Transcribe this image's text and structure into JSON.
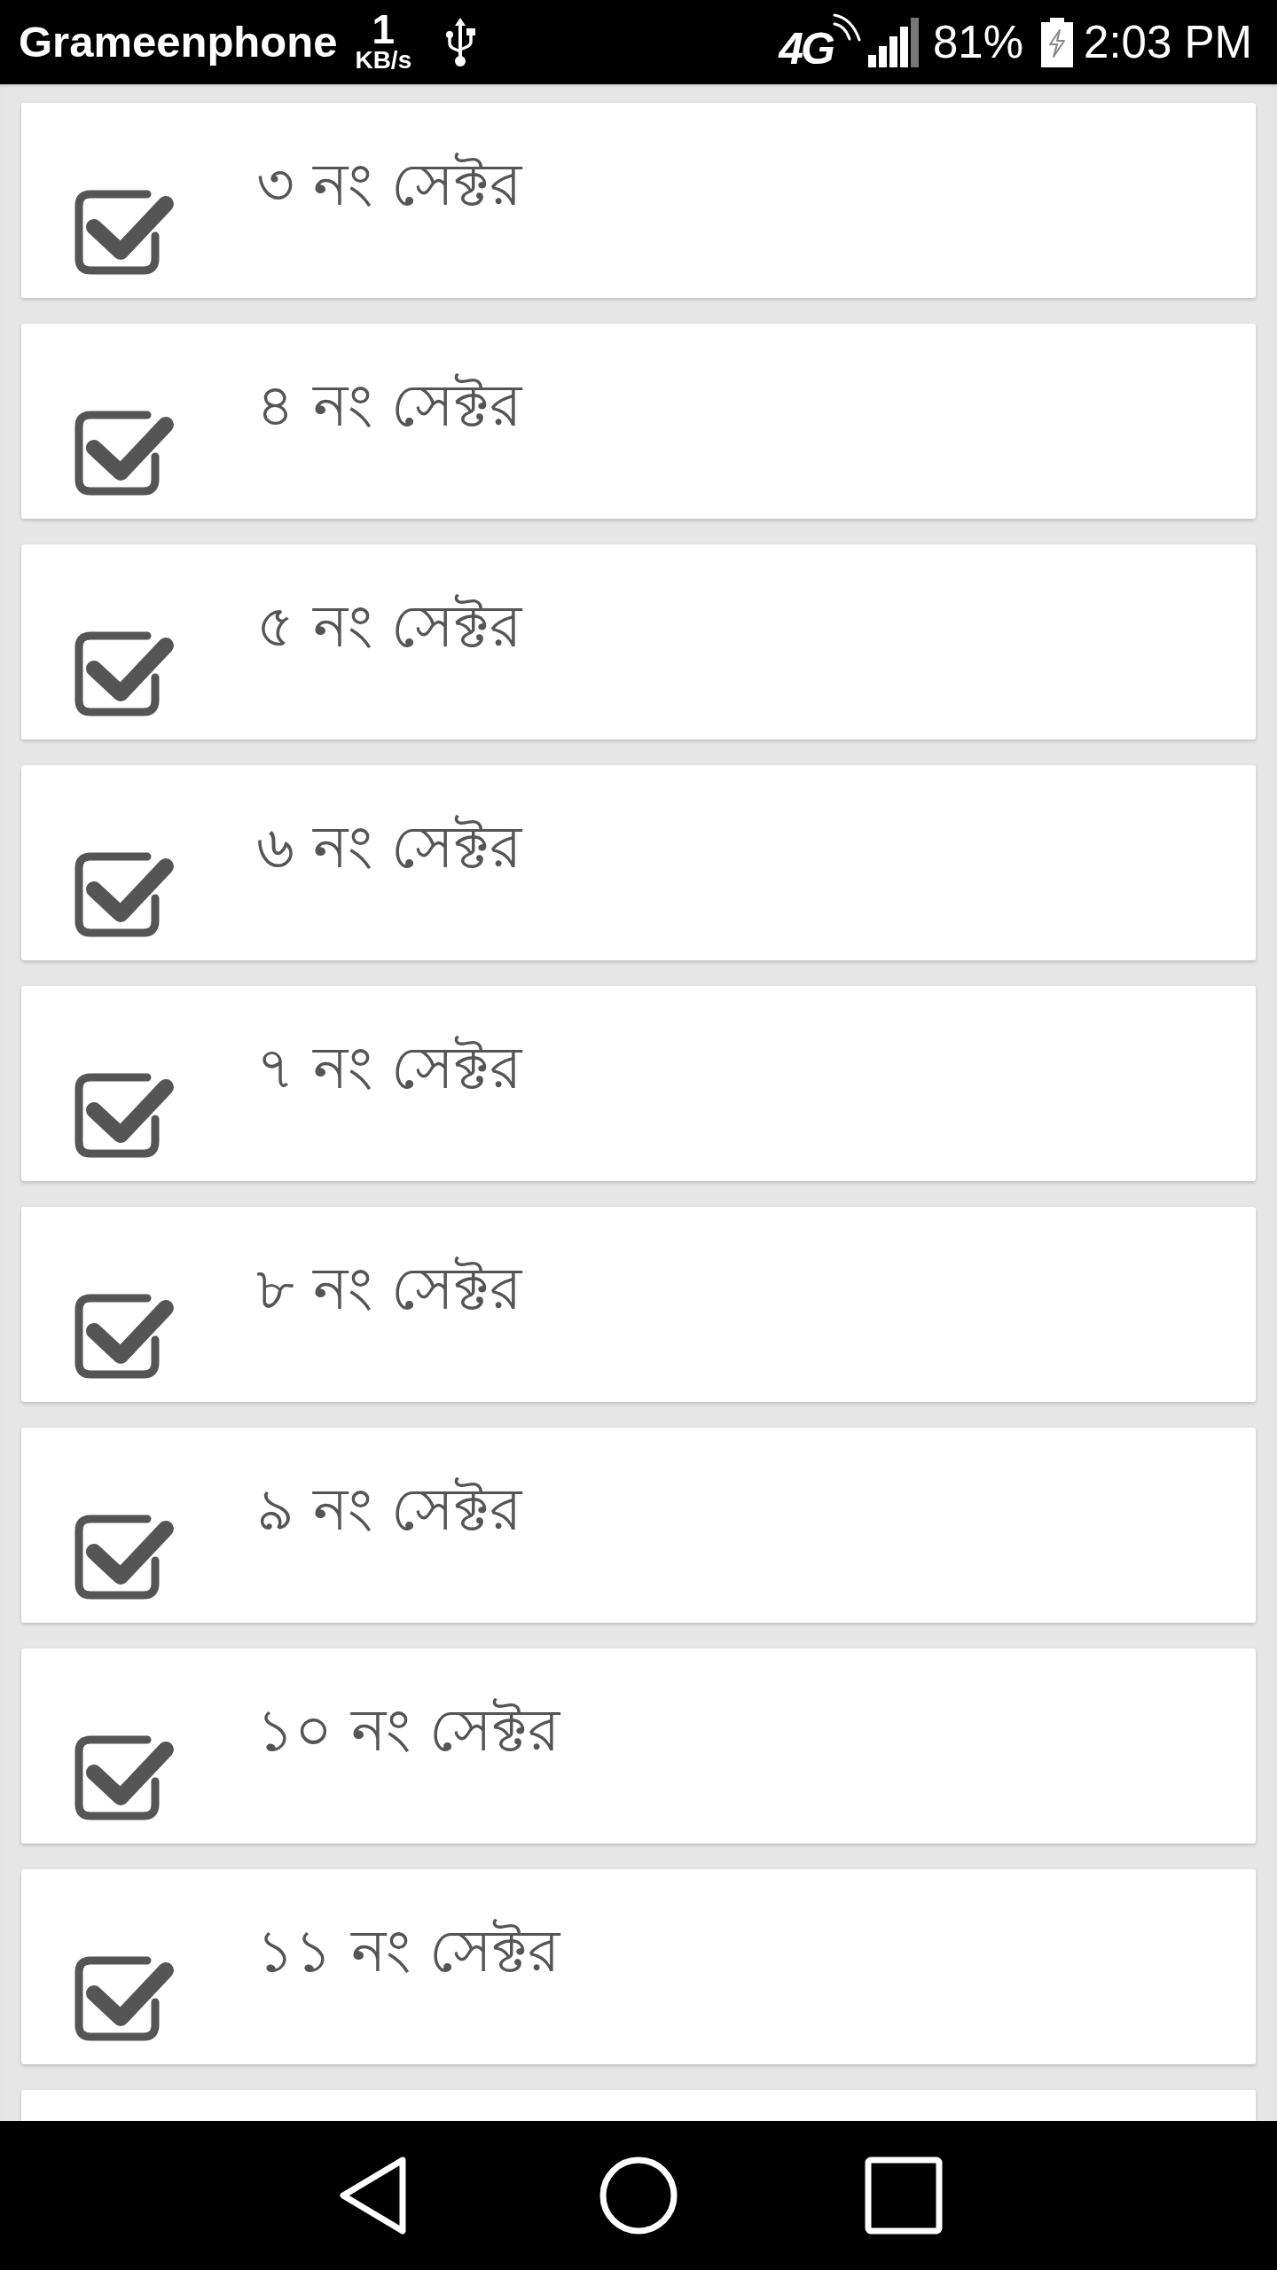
{
  "status_bar": {
    "carrier": "Grameenphone",
    "data_rate": {
      "value": "1",
      "unit": "KB/s"
    },
    "network_type": "4G",
    "battery": "81%",
    "time": "2:03 PM"
  },
  "sectors": [
    {
      "label": "৩ নং সেক্টর",
      "checked": true
    },
    {
      "label": "৪ নং সেক্টর",
      "checked": true
    },
    {
      "label": "৫ নং সেক্টর",
      "checked": true
    },
    {
      "label": "৬ নং সেক্টর",
      "checked": true
    },
    {
      "label": "৭ নং সেক্টর",
      "checked": true
    },
    {
      "label": "৮ নং সেক্টর",
      "checked": true
    },
    {
      "label": "৯ নং সেক্টর",
      "checked": true
    },
    {
      "label": "১০ নং সেক্টর",
      "checked": true
    },
    {
      "label": "১১ নং সেক্টর",
      "checked": true
    }
  ]
}
